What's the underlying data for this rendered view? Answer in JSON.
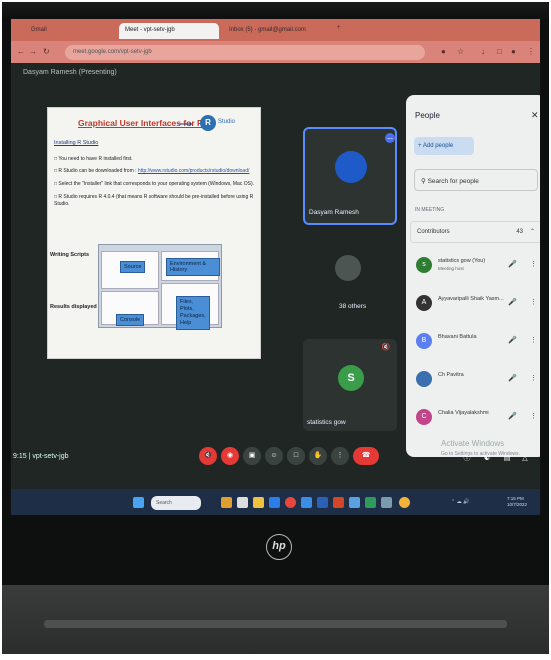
{
  "browser": {
    "tabs": [
      {
        "label": "Gmail"
      },
      {
        "label": "Meet - vpt-setv-jgb"
      },
      {
        "label": "Inbox (5) - gmail@gmail.com"
      }
    ],
    "new_tab": "+",
    "url": "meet.google.com/vpt-setv-jgb"
  },
  "meet": {
    "presenter_label": "Dasyam Ramesh (Presenting)",
    "meeting_code": "vpt-setv-jgb",
    "time": "9:15",
    "tiles": [
      {
        "name": "Dasyam Ramesh"
      },
      {
        "name": "38 others"
      },
      {
        "name": "statistics gow",
        "initial": "S"
      }
    ],
    "activate": {
      "line1": "Activate Windows",
      "line2": "Go to Settings to activate Windows."
    }
  },
  "slide": {
    "title": "Graphical User Interfaces for R",
    "logo_letter": "R",
    "logo_text": "Studio",
    "subtitle": "Installing R Studio",
    "bullets": [
      {
        "text": "You need to have R installed first."
      },
      {
        "text": "R Studio can be downloaded from :",
        "link": "http://www.rstudio.com/products/rstudio/download/"
      },
      {
        "text": "Select the \"Installer\" link that corresponds to your operating system (Windows, Mac OS)."
      },
      {
        "text": "R Studio requires R 4.0.4 (that means R software should be pre-installed before using R Studio."
      }
    ],
    "labels": {
      "writing": "Writing Scripts",
      "results": "Results displayed",
      "source": "Source",
      "env": "Environment & History",
      "console": "Console",
      "files": "Files, Plots, Packages, Help"
    }
  },
  "people": {
    "title": "People",
    "add": "Add people",
    "search": "Search for people",
    "in_meeting": "IN MEETING",
    "contributors": "Contributors",
    "count": "43",
    "rows": [
      {
        "initial": "s",
        "name": "statistics gow (You)",
        "sub": "Meeting host",
        "color": "#2f7d32"
      },
      {
        "initial": "A",
        "name": "Ayyavaripalli Shaik Yasm...",
        "sub": "",
        "color": "#333333"
      },
      {
        "initial": "B",
        "name": "Bhavani Battula",
        "sub": "",
        "color": "#5b7ef0"
      },
      {
        "initial": "",
        "name": "Ch Pavitra",
        "sub": "",
        "color": "#3a6fb0"
      },
      {
        "initial": "C",
        "name": "Chalia Vijayalakshmi",
        "sub": "",
        "color": "#c2448a"
      }
    ]
  },
  "taskbar": {
    "search": "Search",
    "time": "7:15 PM",
    "date": "10/7/2022"
  },
  "brand": "hp",
  "colors": {
    "accent": "#5b8cff",
    "danger": "#e53935",
    "panel": "#eef0ef"
  }
}
